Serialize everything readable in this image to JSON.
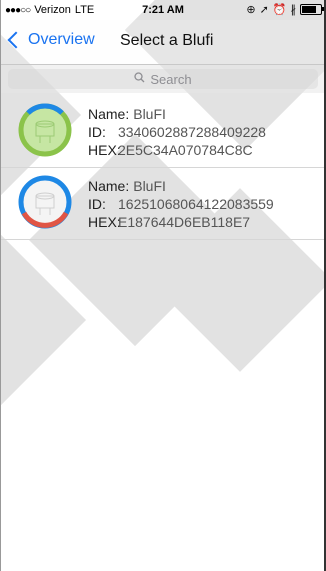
{
  "status_bar": {
    "carrier": "Verizon",
    "network": "LTE",
    "time": "7:21 AM",
    "icons": [
      "lock-rotation-icon",
      "location-icon",
      "alarm-icon",
      "bluetooth-icon",
      "battery-icon"
    ]
  },
  "nav": {
    "back_label": "Overview",
    "title": "Select a Blufi"
  },
  "search": {
    "placeholder": "Search"
  },
  "devices": [
    {
      "name_label": "Name:",
      "name": "BluFI",
      "id_label": "ID:",
      "id": "3340602887288409228",
      "hex_label": "HEX:",
      "hex": "2E5C34A070784C8C",
      "status_color": "#6cc24a"
    },
    {
      "name_label": "Name:",
      "name": "BluFI",
      "id_label": "ID:",
      "id": "16251068064122083559",
      "hex_label": "HEX:",
      "hex": "E187644D6EB118E7",
      "status_color": "#e05545"
    }
  ],
  "colors": {
    "accent": "#1a73f0",
    "ring_blue": "#1e88e5",
    "ring_green": "#8bc34a",
    "ring_red": "#e05545"
  }
}
